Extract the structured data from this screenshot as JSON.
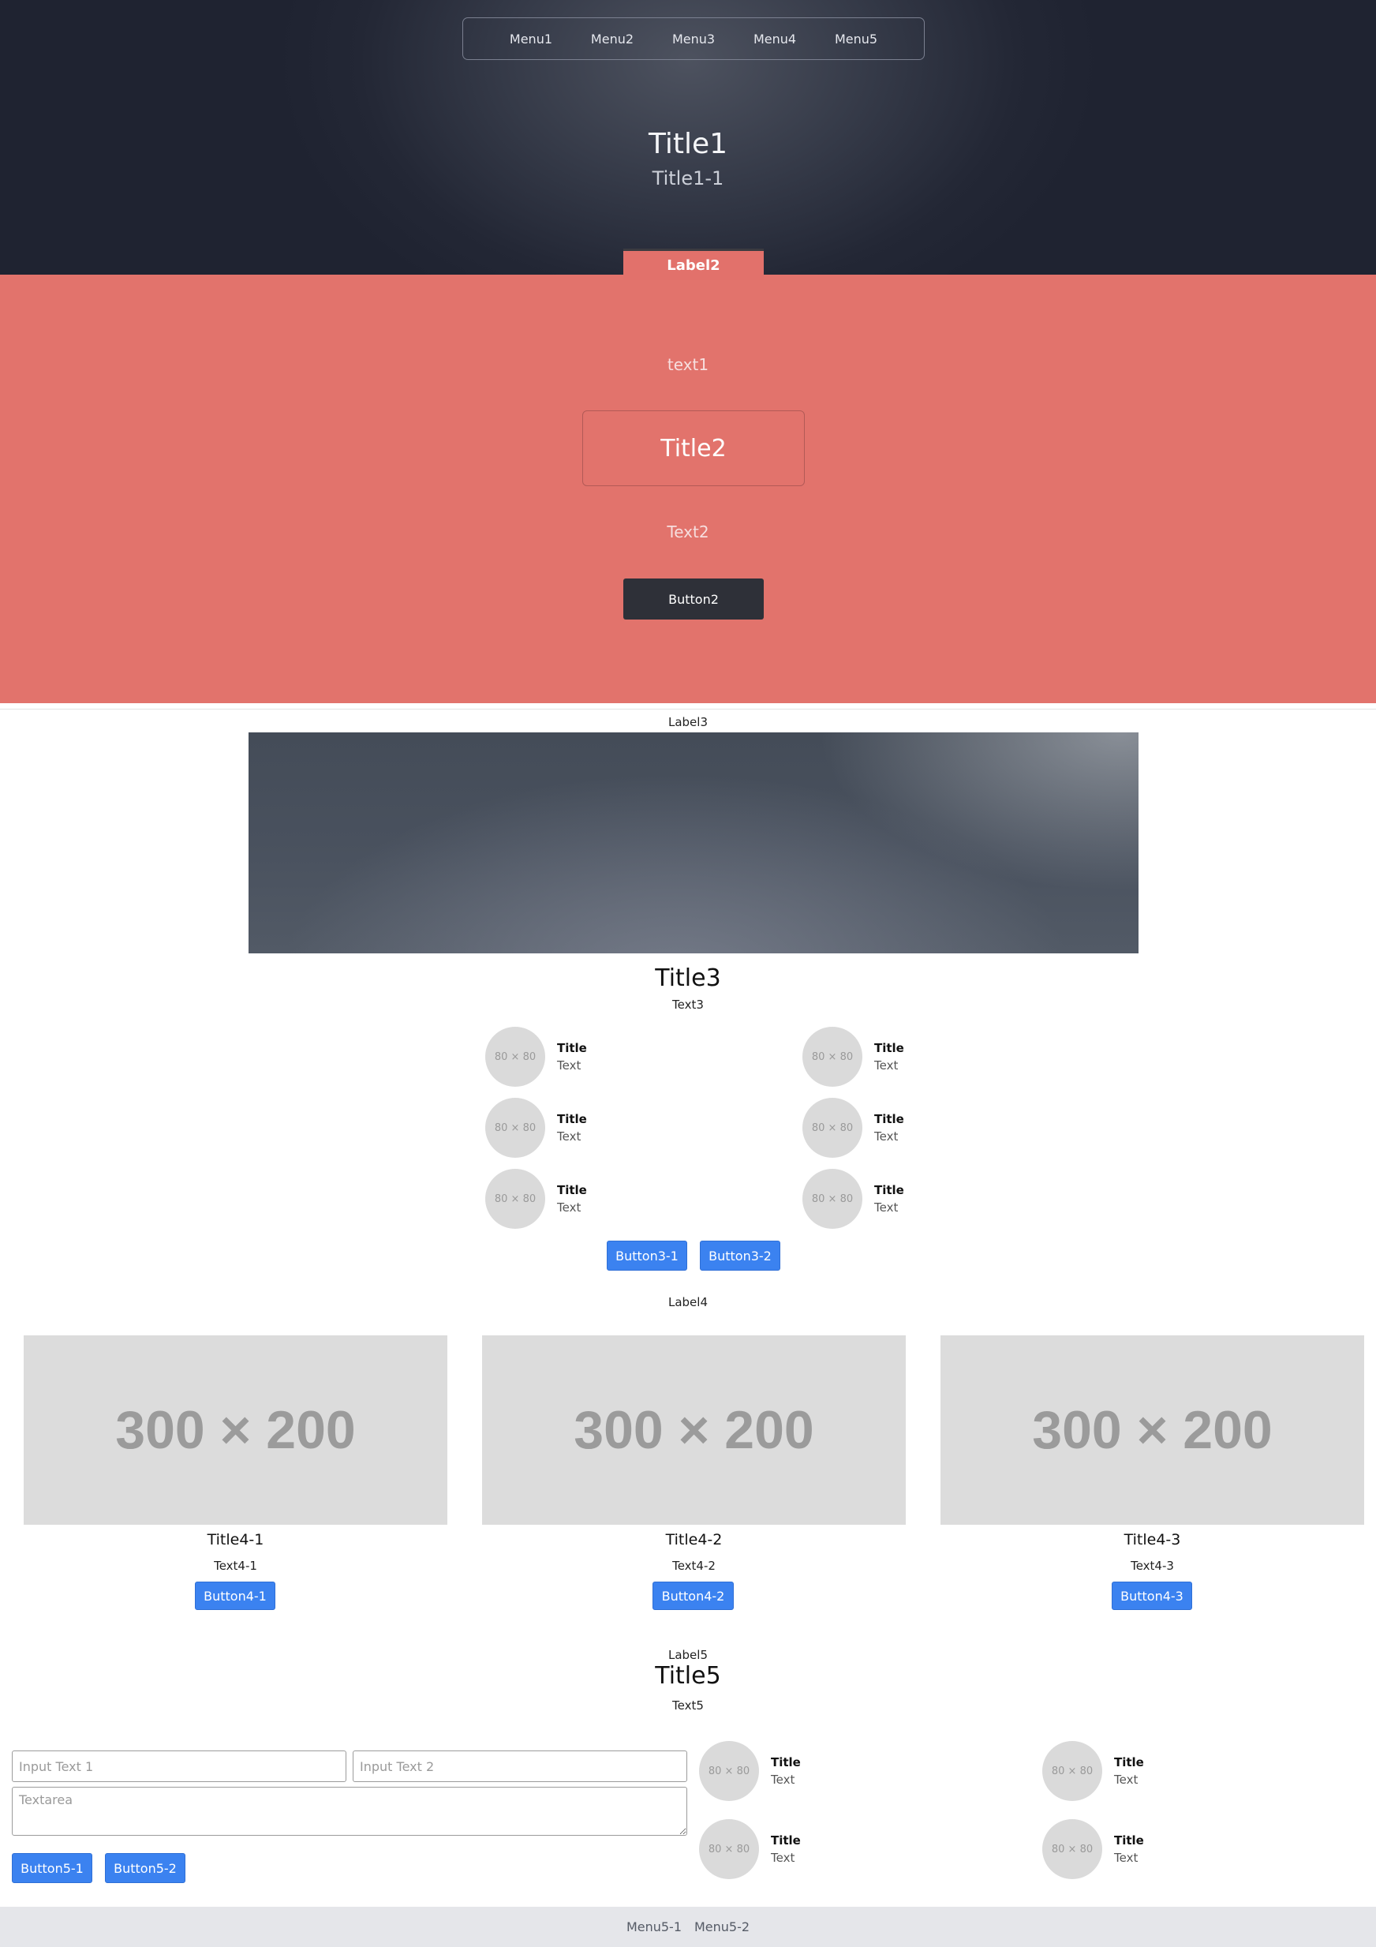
{
  "hero": {
    "nav": [
      "Menu1",
      "Menu2",
      "Menu3",
      "Menu4",
      "Menu5"
    ],
    "title": "Title1",
    "subtitle": "Title1-1",
    "tab_label": "Label2"
  },
  "section2": {
    "text1": "text1",
    "title": "Title2",
    "text2": "Text2",
    "button": "Button2"
  },
  "section3": {
    "label": "Label3",
    "title": "Title3",
    "text": "Text3",
    "items": [
      {
        "avatar": "80 × 80",
        "title": "Title",
        "text": "Text"
      },
      {
        "avatar": "80 × 80",
        "title": "Title",
        "text": "Text"
      },
      {
        "avatar": "80 × 80",
        "title": "Title",
        "text": "Text"
      },
      {
        "avatar": "80 × 80",
        "title": "Title",
        "text": "Text"
      },
      {
        "avatar": "80 × 80",
        "title": "Title",
        "text": "Text"
      },
      {
        "avatar": "80 × 80",
        "title": "Title",
        "text": "Text"
      }
    ],
    "buttons": [
      "Button3-1",
      "Button3-2"
    ]
  },
  "section4": {
    "label": "Label4",
    "cards": [
      {
        "image": "300 × 200",
        "title": "Title4-1",
        "text": "Text4-1",
        "button": "Button4-1"
      },
      {
        "image": "300 × 200",
        "title": "Title4-2",
        "text": "Text4-2",
        "button": "Button4-2"
      },
      {
        "image": "300 × 200",
        "title": "Title4-3",
        "text": "Text4-3",
        "button": "Button4-3"
      }
    ]
  },
  "section5": {
    "label": "Label5",
    "title": "Title5",
    "text": "Text5",
    "form": {
      "input1_placeholder": "Input Text 1",
      "input2_placeholder": "Input Text 2",
      "textarea_placeholder": "Textarea",
      "buttons": [
        "Button5-1",
        "Button5-2"
      ]
    },
    "items": [
      {
        "avatar": "80 × 80",
        "title": "Title",
        "text": "Text"
      },
      {
        "avatar": "80 × 80",
        "title": "Title",
        "text": "Text"
      },
      {
        "avatar": "80 × 80",
        "title": "Title",
        "text": "Text"
      },
      {
        "avatar": "80 × 80",
        "title": "Title",
        "text": "Text"
      }
    ]
  },
  "footer": {
    "links": [
      "Menu5-1",
      "Menu5-2"
    ]
  },
  "colors": {
    "hero_bg": "#232735",
    "section2_bg": "#e2736c",
    "dark_button": "#2e3038",
    "primary_button": "#3b82f0",
    "placeholder_bg": "#dcdcdc",
    "footer_bg": "#e5e6ea"
  }
}
